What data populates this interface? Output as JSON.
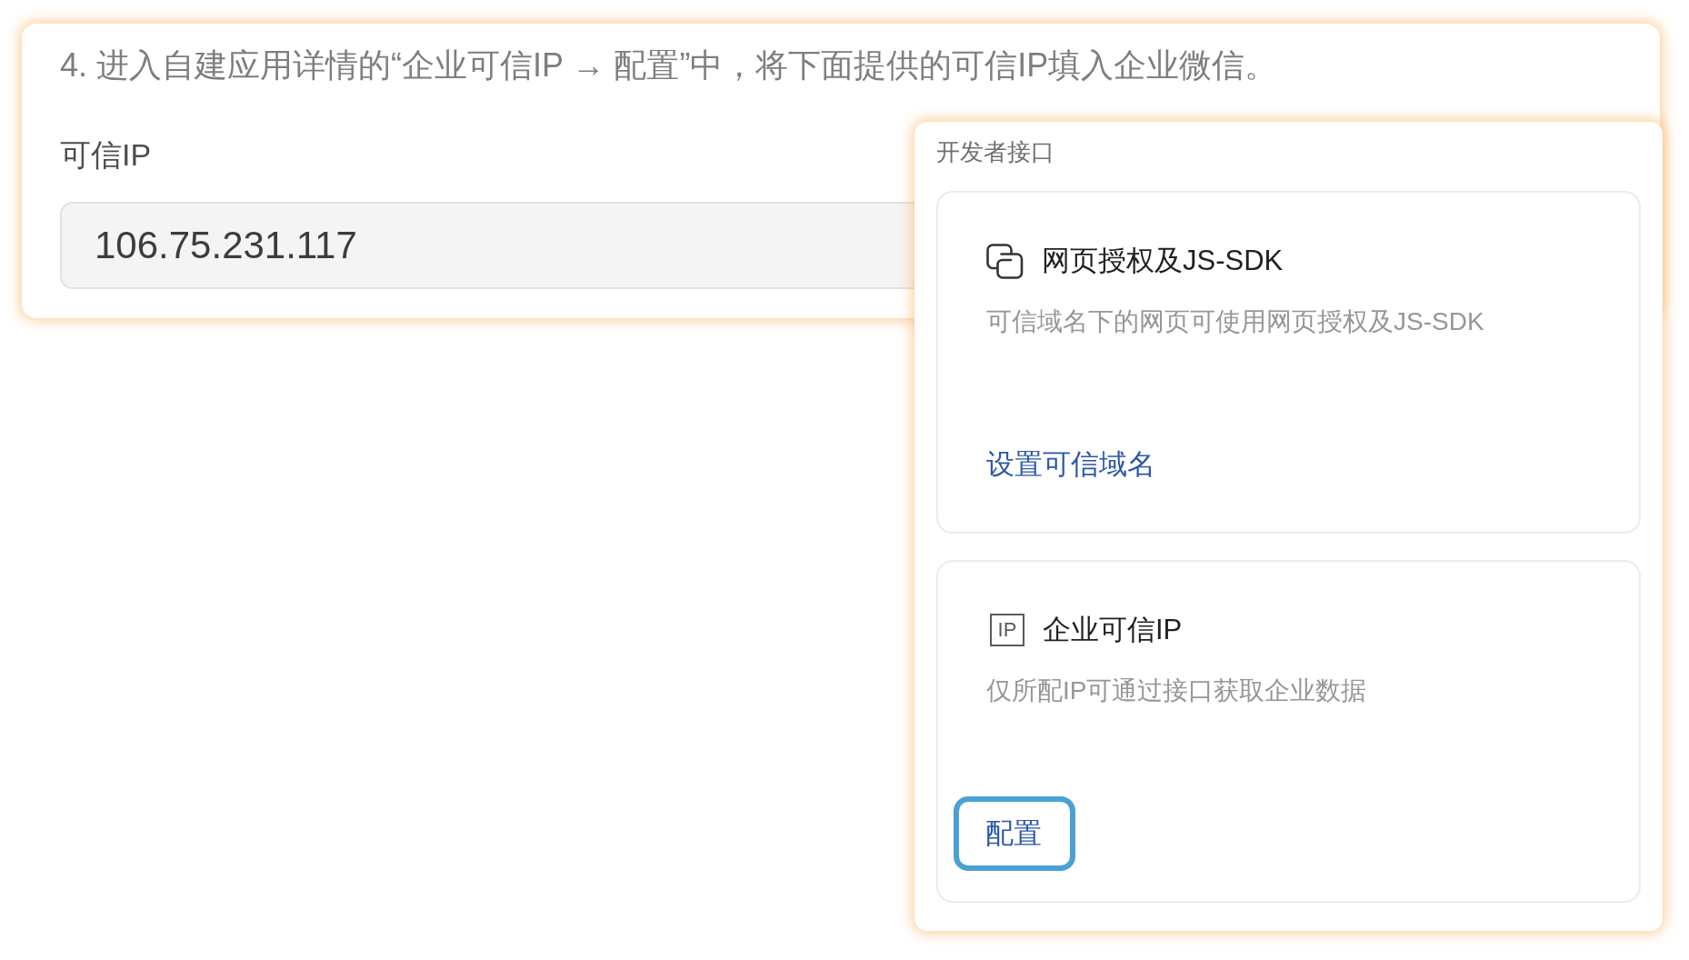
{
  "instruction_card": {
    "step_text": "4. 进入自建应用详情的“企业可信IP → 配置”中，将下面提供的可信IP填入企业微信。",
    "field_label": "可信IP",
    "ip_field": {
      "value": "106.75.231.117"
    }
  },
  "developer_panel": {
    "title": "开发者接口",
    "cards": [
      {
        "kind": "webpage",
        "title": "网页授权及JS-SDK",
        "description": "可信域名下的网页可使用网页授权及JS-SDK",
        "action": {
          "label": "设置可信域名",
          "highlighted": false
        }
      },
      {
        "kind": "ip",
        "icon_text": "IP",
        "title": "企业可信IP",
        "description": "仅所配IP可通过接口获取企业数据",
        "action": {
          "label": "配置",
          "highlighted": true
        }
      }
    ]
  }
}
